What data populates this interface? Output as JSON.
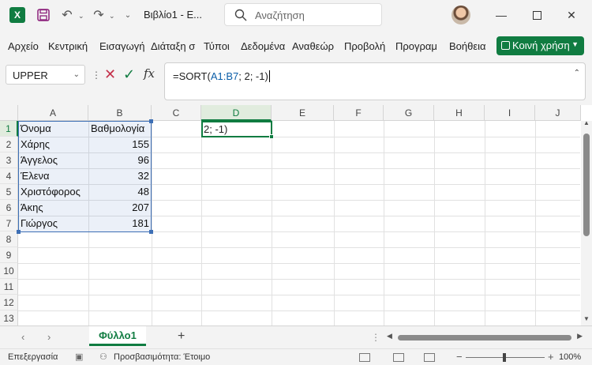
{
  "titlebar": {
    "doc_title": "Βιβλίο1 - Ε...",
    "search_placeholder": "Αναζήτηση",
    "app_logo": "X"
  },
  "ribbon": {
    "tabs": [
      "Αρχείο",
      "Κεντρική",
      "Εισαγωγή",
      "Διάταξη σ",
      "Τύποι",
      "Δεδομένα",
      "Αναθεώρ",
      "Προβολή",
      "Προγραμ",
      "Βοήθεια"
    ],
    "share_label": "Κοινή χρήση"
  },
  "formula_bar": {
    "name_box": "UPPER",
    "formula_prefix": "=SORT(",
    "formula_ref": "A1:B7",
    "formula_suffix": "; 2; -1)"
  },
  "grid": {
    "columns": [
      "A",
      "B",
      "C",
      "D",
      "E",
      "F",
      "G",
      "H",
      "I",
      "J"
    ],
    "rows": [
      "1",
      "2",
      "3",
      "4",
      "5",
      "6",
      "7",
      "8",
      "9",
      "10",
      "11",
      "12",
      "13"
    ],
    "header_row": [
      "Όνομα",
      "Βαθμολογία"
    ],
    "data": [
      [
        "Χάρης",
        "155"
      ],
      [
        "Άγγελος",
        "96"
      ],
      [
        "Έλενα",
        "32"
      ],
      [
        "Χριστόφορος",
        "48"
      ],
      [
        "Άκης",
        "207"
      ],
      [
        "Γιώργος",
        "181"
      ]
    ],
    "active_cell_text": "2; -1)"
  },
  "sheets": {
    "active_tab": "Φύλλο1",
    "add": "+"
  },
  "status": {
    "mode": "Επεξεργασία",
    "accessibility": "Προσβασιμότητα: Έτοιμο",
    "zoom": "100%"
  },
  "colors": {
    "accent": "#107c41",
    "selection": "#3d6fb5"
  }
}
